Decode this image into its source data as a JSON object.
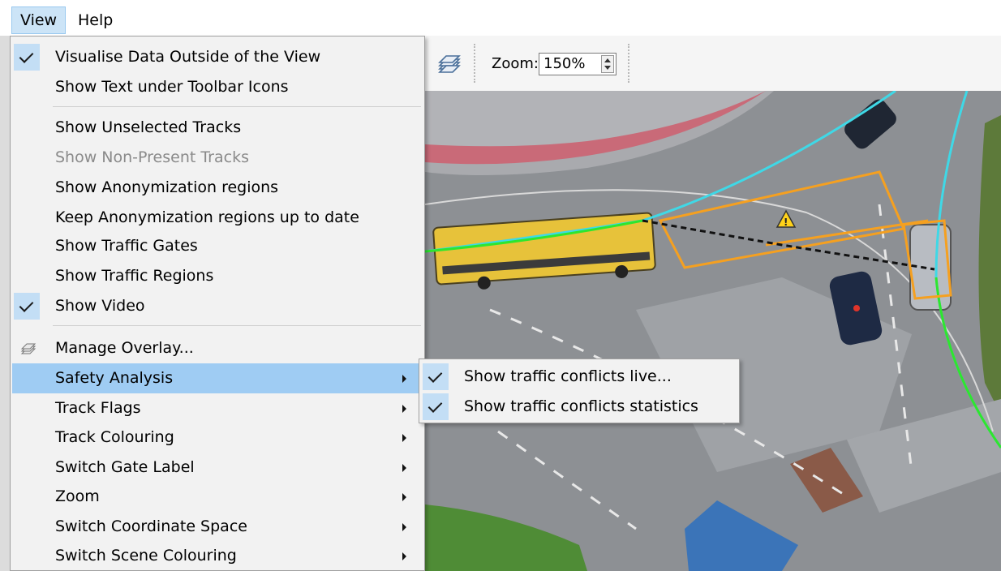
{
  "menubar": {
    "view": "View",
    "help": "Help"
  },
  "toolbar": {
    "zoom_label": "Zoom:",
    "zoom_value": "150%"
  },
  "view_menu": {
    "items": [
      {
        "label": "Visualise Data Outside of the View",
        "checked": true
      },
      {
        "label": "Show Text under Toolbar Icons",
        "checked": false
      },
      {
        "label": "Show Unselected Tracks",
        "checked": false
      },
      {
        "label": "Show Non-Present Tracks",
        "checked": false,
        "disabled": true
      },
      {
        "label": "Show Anonymization regions",
        "checked": false
      },
      {
        "label": "Keep Anonymization regions up to date",
        "checked": false
      },
      {
        "label": "Show Traffic Gates",
        "checked": false
      },
      {
        "label": "Show Traffic Regions",
        "checked": false
      },
      {
        "label": "Show Video",
        "checked": true
      },
      {
        "label": "Manage Overlay...",
        "icon": "layers-icon"
      },
      {
        "label": "Safety Analysis",
        "submenu": true,
        "highlighted": true
      },
      {
        "label": "Track Flags",
        "submenu": true
      },
      {
        "label": "Track Colouring",
        "submenu": true
      },
      {
        "label": "Switch Gate Label",
        "submenu": true
      },
      {
        "label": "Zoom",
        "submenu": true
      },
      {
        "label": "Switch Coordinate Space",
        "submenu": true
      },
      {
        "label": "Switch Scene Colouring",
        "submenu": true
      }
    ]
  },
  "safety_submenu": {
    "items": [
      {
        "label": "Show traffic conflicts live...",
        "checked": true
      },
      {
        "label": "Show traffic conflicts statistics",
        "checked": true
      }
    ]
  },
  "colors": {
    "highlight": "#9fccf3",
    "check_bg": "#c3def5",
    "track_green": "#2ee62e",
    "track_cyan": "#3fd8e6",
    "conflict_orange": "#f5a020"
  }
}
